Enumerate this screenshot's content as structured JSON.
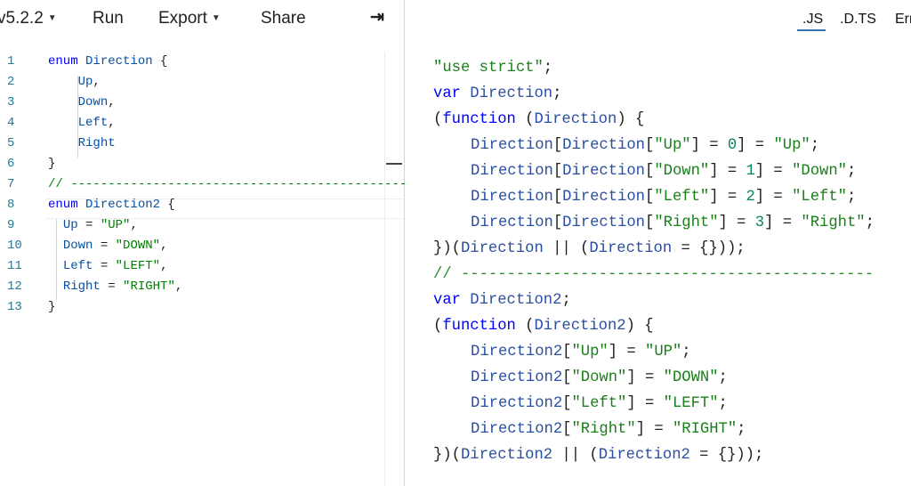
{
  "toolbar": {
    "version": "v5.2.2",
    "run": "Run",
    "export": "Export",
    "share": "Share",
    "toggle_icon": "⇥"
  },
  "tabs": {
    "js": ".JS",
    "dts": ".D.TS",
    "errors": "Err"
  },
  "editor": {
    "line_numbers": [
      "1",
      "2",
      "3",
      "4",
      "5",
      "6",
      "7",
      "8",
      "9",
      "10",
      "11",
      "12",
      "13"
    ],
    "lines": [
      "enum Direction {",
      "    Up,",
      "    Down,",
      "    Left,",
      "    Right",
      "}",
      "// ---------------------------------------------",
      "enum Direction2 {",
      "  Up = \"UP\",",
      "  Down = \"DOWN\",",
      "  Left = \"LEFT\",",
      "  Right = \"RIGHT\",",
      "}"
    ]
  },
  "output": {
    "lines": [
      "\"use strict\";",
      "var Direction;",
      "(function (Direction) {",
      "Direction[Direction[\"Up\"] = 0] = \"Up\";",
      "Direction[Direction[\"Down\"] = 1] = \"Down\";",
      "Direction[Direction[\"Left\"] = 2] = \"Left\";",
      "Direction[Direction[\"Right\"] = 3] = \"Right\";",
      "})(Direction || (Direction = {}));",
      "// ---------------------------------------------",
      "var Direction2;",
      "(function (Direction2) {",
      "Direction2[\"Up\"] = \"UP\";",
      "Direction2[\"Down\"] = \"DOWN\";",
      "Direction2[\"Left\"] = \"LEFT\";",
      "Direction2[\"Right\"] = \"RIGHT\";",
      "})(Direction2 || (Direction2 = {}));"
    ]
  },
  "colors": {
    "keyword": "#0000ff",
    "identifier": "#2a4fa0",
    "string": "#1a7f1a",
    "comment": "#2d8a2d",
    "line_number": "#237893",
    "tab_underline": "#2f6fb3"
  }
}
